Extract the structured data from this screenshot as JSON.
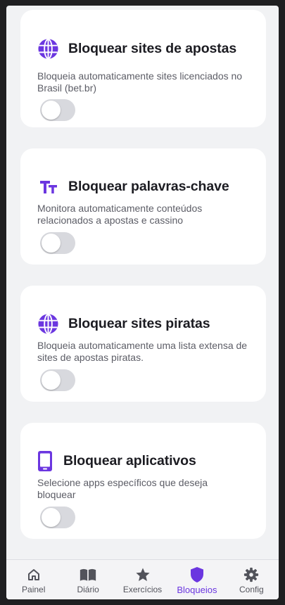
{
  "colors": {
    "accent": "#6b36e0",
    "toggle_off": "#d8d9de",
    "nav_inactive": "#52535b"
  },
  "cards": [
    {
      "icon": "globe-icon",
      "title": "Bloquear sites de apostas",
      "description": "Bloqueia automaticamente sites licenciados no Brasil (bet.br)",
      "enabled": false
    },
    {
      "icon": "text-size-icon",
      "title": "Bloquear palavras-chave",
      "description": "Monitora automaticamente conteúdos relacionados a apostas e cassino",
      "enabled": false
    },
    {
      "icon": "globe-icon",
      "title": "Bloquear sites piratas",
      "description": "Bloqueia automaticamente uma lista extensa de sites de apostas piratas.",
      "enabled": false
    },
    {
      "icon": "smartphone-icon",
      "title": "Bloquear aplicativos",
      "description": "Selecione apps específicos que deseja bloquear",
      "enabled": false
    }
  ],
  "nav": {
    "active": "Bloqueios",
    "items": [
      {
        "label": "Painel",
        "icon": "home-icon"
      },
      {
        "label": "Diário",
        "icon": "book-icon"
      },
      {
        "label": "Exercícios",
        "icon": "star-icon"
      },
      {
        "label": "Bloqueios",
        "icon": "shield-icon"
      },
      {
        "label": "Config",
        "icon": "gear-icon"
      }
    ]
  }
}
